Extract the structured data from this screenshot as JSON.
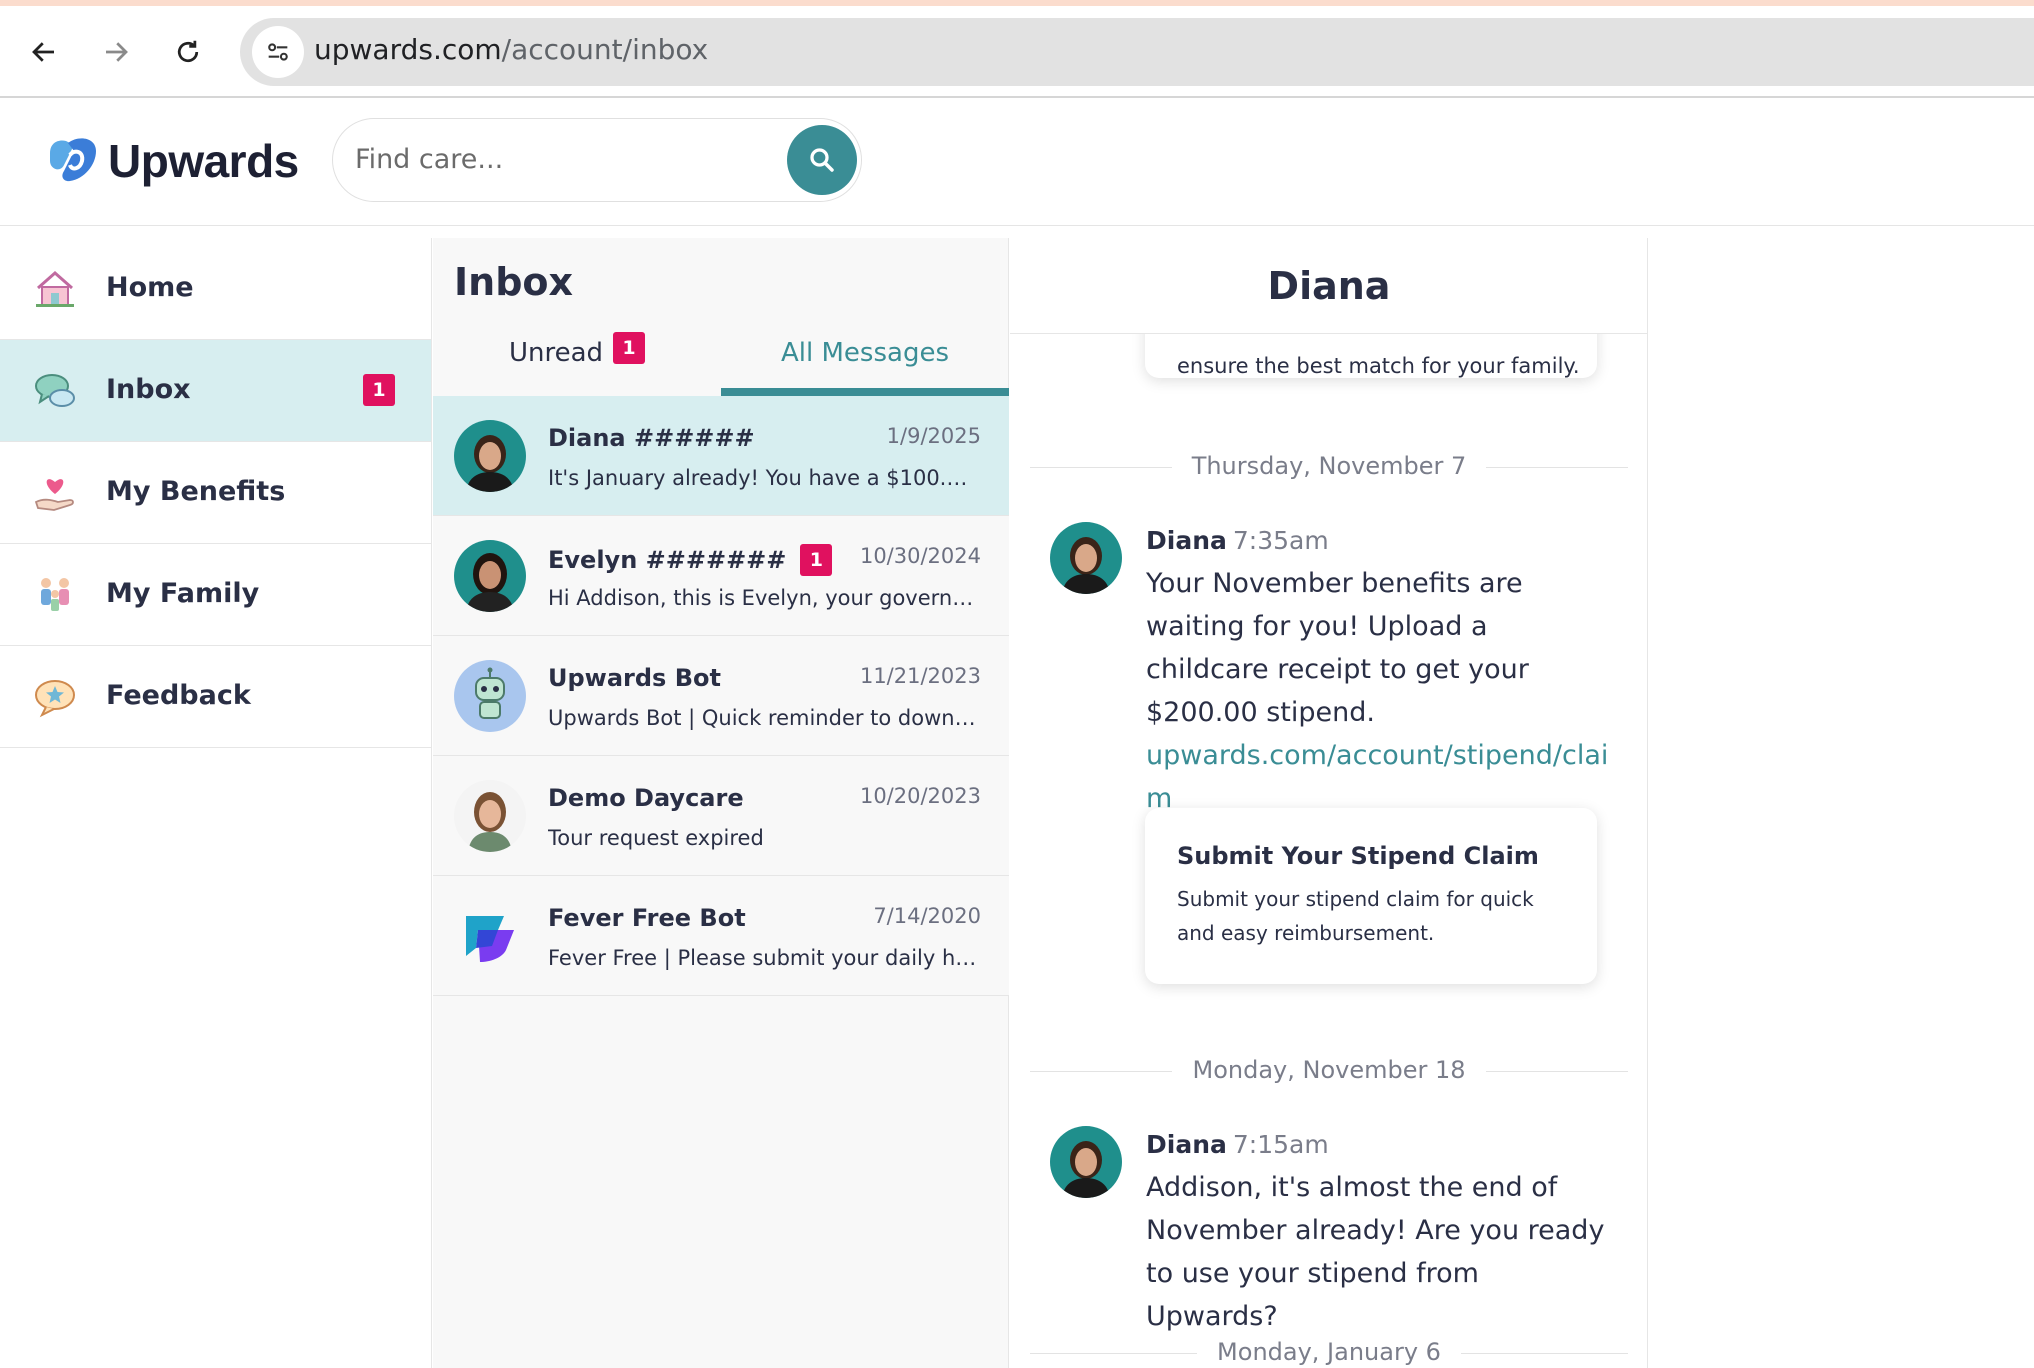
{
  "browser": {
    "url_domain": "upwards.com",
    "url_path": "/account/inbox"
  },
  "app": {
    "logo_text": "Upwards",
    "search_placeholder": "Find care..."
  },
  "sidebar": {
    "items": [
      {
        "label": "Home",
        "icon": "house-icon",
        "active": false
      },
      {
        "label": "Inbox",
        "icon": "chat-bubbles-icon",
        "active": true,
        "badge": "1"
      },
      {
        "label": "My Benefits",
        "icon": "heart-hand-icon",
        "active": false
      },
      {
        "label": "My Family",
        "icon": "family-icon",
        "active": false
      },
      {
        "label": "Feedback",
        "icon": "star-bubble-icon",
        "active": false
      }
    ]
  },
  "inbox": {
    "title": "Inbox",
    "tabs": [
      {
        "label": "Unread",
        "badge": "1",
        "active": false
      },
      {
        "label": "All Messages",
        "active": true
      }
    ],
    "threads": [
      {
        "name": "Diana ######",
        "date": "1/9/2025",
        "snippet": "It's January already! You have a $100.00 f...",
        "active": true,
        "avatar": "person-photo"
      },
      {
        "name": "Evelyn #######",
        "badge": "1",
        "date": "10/30/2024",
        "snippet": "Hi Addison, this is Evelyn, your governme...",
        "active": false,
        "avatar": "person-photo"
      },
      {
        "name": "Upwards Bot",
        "date": "11/21/2023",
        "snippet": "Upwards Bot | Quick reminder to downlo...",
        "active": false,
        "avatar": "robot-icon"
      },
      {
        "name": "Demo Daycare",
        "date": "10/20/2023",
        "snippet": "Tour request expired",
        "active": false,
        "avatar": "person-photo"
      },
      {
        "name": "Fever Free Bot",
        "date": "7/14/2020",
        "snippet": "Fever Free | Please submit your daily heal...",
        "active": false,
        "avatar": "fever-free-logo"
      }
    ]
  },
  "conversation": {
    "title": "Diana",
    "cut_off_text": "ensure the best match for your family.",
    "days": [
      {
        "label": "Thursday, November 7"
      },
      {
        "label": "Monday, November 18"
      },
      {
        "label": "Monday, January 6"
      }
    ],
    "messages": [
      {
        "sender": "Diana",
        "time": "7:35am",
        "body": "Your November benefits are waiting for you! Upload a childcare receipt to get your $200.00 stipend.",
        "link": "upwards.com/account/stipend/claim",
        "card_title": "Submit Your Stipend Claim",
        "card_desc": "Submit your stipend claim for quick and easy reimbursement."
      },
      {
        "sender": "Diana",
        "time": "7:15am",
        "body": "Addison, it's almost the end of November already! Are you ready to use your stipend from Upwards?"
      }
    ]
  },
  "colors": {
    "accent": "#3a8d95",
    "active_bg": "#d7eef0",
    "badge": "#e0115f"
  }
}
